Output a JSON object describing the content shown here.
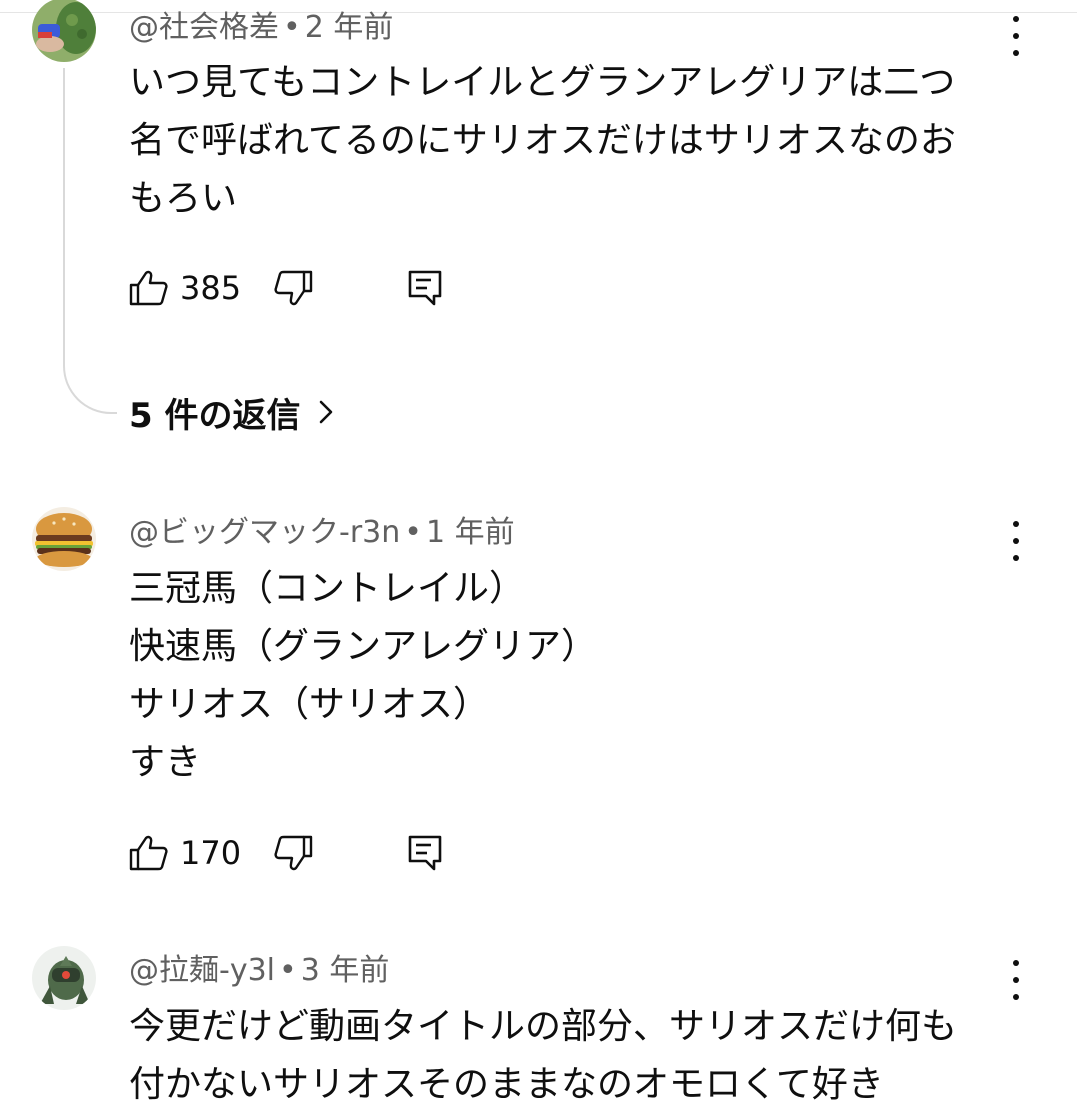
{
  "comments": [
    {
      "author": "@社会格差",
      "age": "2 年前",
      "text": "いつ見てもコントレイルとグランアレグリアは二つ\n名で呼ばれてるのにサリオスだけはサリオスなのお\nもろい",
      "likes": "385",
      "replies_label": "5 件の返信"
    },
    {
      "author": "@ビッグマック-r3n",
      "age": "1 年前",
      "text": "三冠馬（コントレイル）\n快速馬（グランアレグリア）\nサリオス（サリオス）\nすき",
      "likes": "170"
    },
    {
      "author": "@拉麺-y3l",
      "age": "3 年前",
      "text": "今更だけど動画タイトルの部分、サリオスだけ何も\n付かないサリオスそのままなのオモロくて好き"
    }
  ],
  "separator": "•",
  "icons": {
    "like": "thumbs-up-icon",
    "dislike": "thumbs-down-icon",
    "reply": "reply-comment-icon",
    "more": "more-vert-icon",
    "replies_chevron": "chevron-right-icon"
  },
  "colors": {
    "text": "#0f0f0f",
    "meta": "#606060",
    "thread_line": "#d9d9d9"
  }
}
